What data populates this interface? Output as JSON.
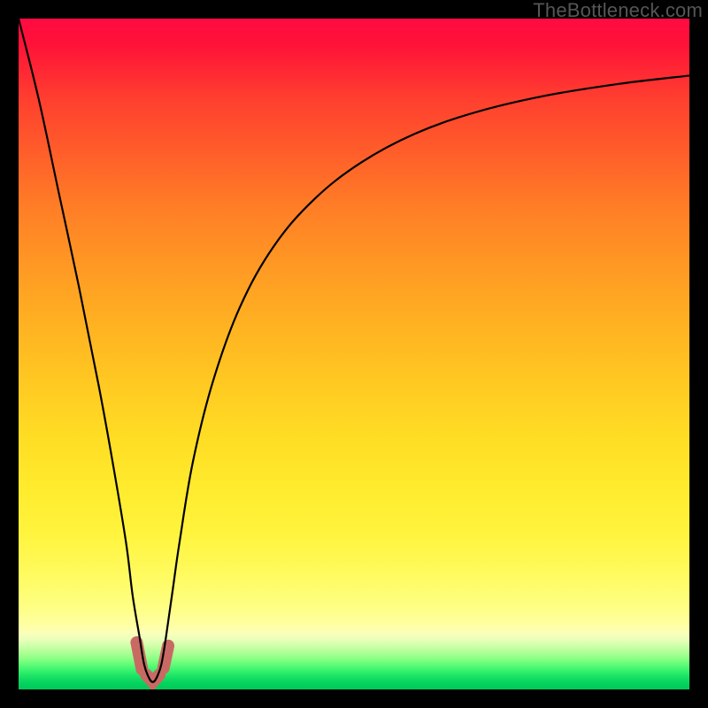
{
  "watermark": "TheBottleneck.com",
  "chart_data": {
    "type": "line",
    "title": "",
    "xlabel": "",
    "ylabel": "",
    "xlim": [
      0,
      100
    ],
    "ylim": [
      0,
      100
    ],
    "grid": false,
    "legend": false,
    "note": "Percent-of-plot coordinates; y=0 is bottom (green), y=100 is top (red). The curve represents a bottleneck metric with a sharp minimum near x≈20 and an asymptotic rise toward the right.",
    "series": [
      {
        "name": "bottleneck-curve",
        "x": [
          0,
          3,
          6,
          9,
          12,
          14,
          16,
          17,
          18,
          18.7,
          19.4,
          20,
          20.6,
          21.3,
          22,
          23,
          24,
          26,
          29,
          33,
          38,
          44,
          51,
          59,
          68,
          78,
          89,
          100
        ],
        "y": [
          100,
          88,
          74,
          60,
          45,
          34,
          22,
          14,
          8,
          3.8,
          1.8,
          1.1,
          1.8,
          3.8,
          8,
          15,
          22,
          34,
          46,
          57,
          66,
          73,
          78.5,
          82.8,
          86,
          88.4,
          90.2,
          91.5
        ]
      }
    ],
    "markers": [
      {
        "name": "left-descent-marker",
        "x": [
          17.6,
          18.4
        ],
        "y": [
          7.0,
          3.0
        ]
      },
      {
        "name": "trough-marker",
        "x": [
          19.0,
          20.0,
          21.0
        ],
        "y": [
          2.2,
          1.1,
          2.2
        ]
      },
      {
        "name": "right-ascent-marker",
        "x": [
          21.6,
          22.3
        ],
        "y": [
          3.2,
          6.5
        ]
      }
    ]
  }
}
